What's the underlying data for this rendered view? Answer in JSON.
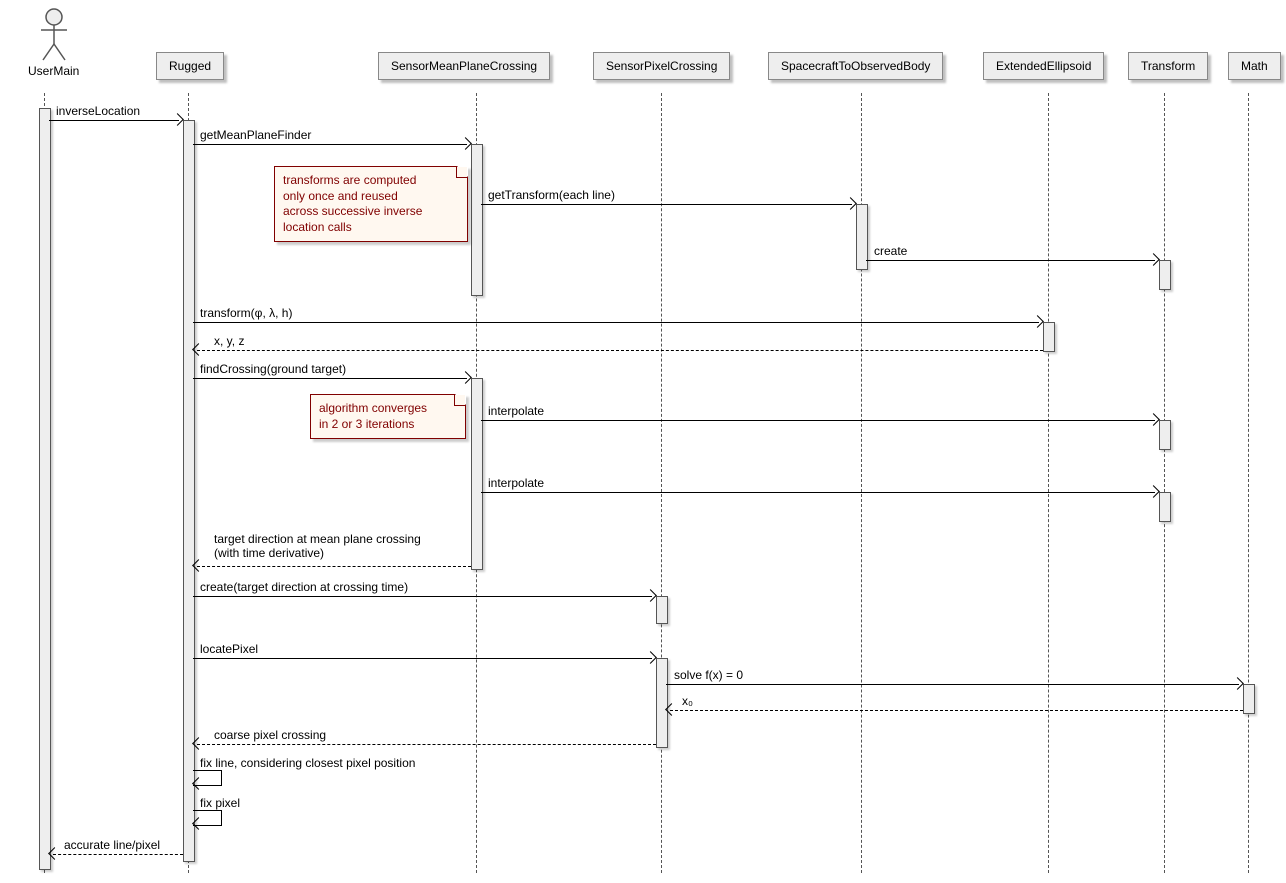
{
  "participants": {
    "user": "UserMain",
    "rugged": "Rugged",
    "smpc": "SensorMeanPlaneCrossing",
    "spc": "SensorPixelCrossing",
    "stob": "SpacecraftToObservedBody",
    "ee": "ExtendedEllipsoid",
    "transform": "Transform",
    "math": "Math"
  },
  "messages": {
    "inverseLocation": "inverseLocation",
    "getMeanPlaneFinder": "getMeanPlaneFinder",
    "getTransformEachLine": "getTransform(each line)",
    "create": "create",
    "transformPhi": "transform(φ, λ, h)",
    "xyz": "x, y, z",
    "findCrossing": "findCrossing(ground target)",
    "interpolate1": "interpolate",
    "interpolate2": "interpolate",
    "targetDirection": "target direction at mean plane crossing\n(with time derivative)",
    "createTargetDir": "create(target direction at crossing time)",
    "locatePixel": "locatePixel",
    "solveFx": "solve f(x) = 0",
    "x0": "x₀",
    "coarsePixel": "coarse pixel crossing",
    "fixLine": "fix line, considering closest pixel position",
    "fixPixel": "fix pixel",
    "accurateLinePixel": "accurate line/pixel"
  },
  "notes": {
    "transformsNote": "transforms are computed\nonly once and reused\nacross successive inverse\nlocation calls",
    "convergeNote": "algorithm converges\nin 2 or 3 iterations"
  }
}
